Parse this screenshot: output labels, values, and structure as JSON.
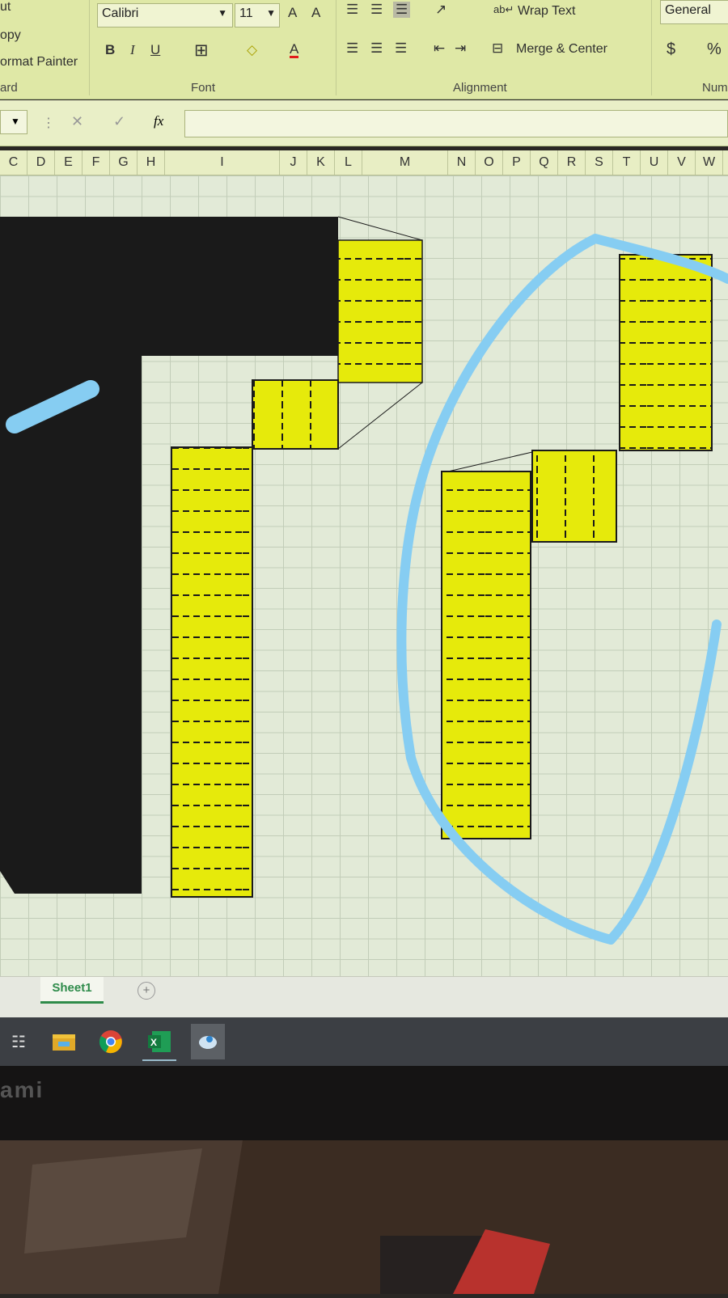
{
  "ribbon": {
    "clipboard": {
      "cut_label": "ut",
      "copy_label": "opy",
      "painter_label": "ormat Painter",
      "group_label": "ard"
    },
    "font": {
      "font_name": "Calibri",
      "font_size": "11",
      "grow_label": "A",
      "shrink_label": "A",
      "bold_label": "B",
      "italic_label": "I",
      "underline_label": "U",
      "font_color_label": "A",
      "group_label": "Font"
    },
    "alignment": {
      "wrap_text_label": "Wrap Text",
      "merge_label": "Merge & Center",
      "group_label": "Alignment"
    },
    "number": {
      "format_value": "General",
      "currency_label": "$",
      "percent_label": "%",
      "group_label": "Num"
    }
  },
  "formula_bar": {
    "fx_label": "fx",
    "cancel_label": "✕",
    "enter_label": "✓",
    "formula_value": ""
  },
  "columns": [
    "C",
    "D",
    "E",
    "F",
    "G",
    "H",
    "I",
    "J",
    "K",
    "L",
    "M",
    "N",
    "O",
    "P",
    "Q",
    "R",
    "S",
    "T",
    "U",
    "V",
    "W"
  ],
  "sheet_tabs": {
    "active": "Sheet1",
    "add_label": "+"
  },
  "monitor": {
    "brand": "ami"
  },
  "colors": {
    "fill_yellow": "#e6ea0b",
    "black_fill": "#1a1a1a",
    "annotation_blue": "#86cdf2",
    "ribbon": "#dfe8a6"
  }
}
